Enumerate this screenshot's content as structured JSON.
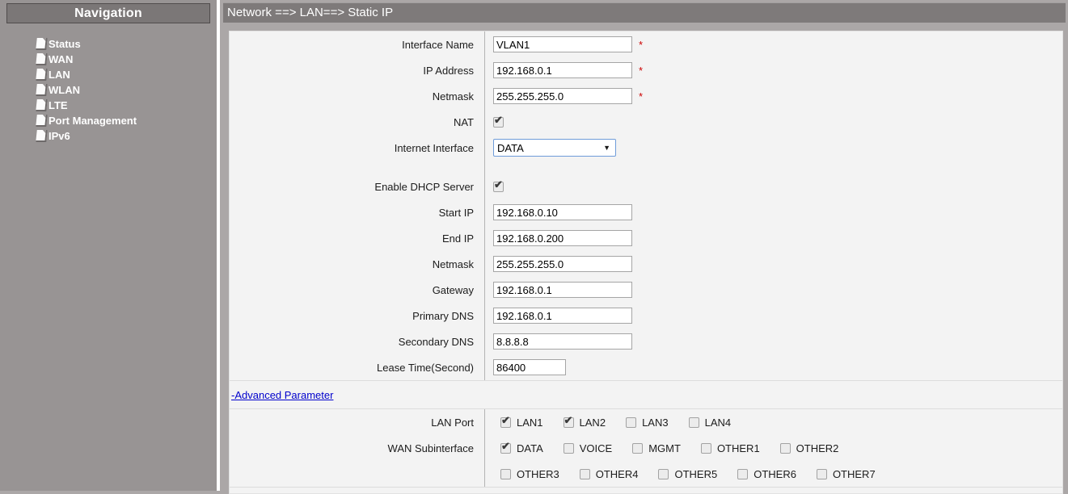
{
  "sidebar": {
    "title": "Navigation",
    "items": [
      "Status",
      "WAN",
      "LAN",
      "WLAN",
      "LTE",
      "Port Management",
      "IPv6"
    ]
  },
  "breadcrumb": "Network ==> LAN==> Static IP",
  "form": {
    "required_marker": "*",
    "sections": [
      {
        "rows": [
          {
            "label": "Interface Name",
            "type": "text",
            "value": "VLAN1",
            "required": true
          },
          {
            "label": "IP Address",
            "type": "text",
            "value": "192.168.0.1",
            "required": true
          },
          {
            "label": "Netmask",
            "type": "text",
            "value": "255.255.255.0",
            "required": true
          },
          {
            "label": "NAT",
            "type": "checkbox",
            "checked": true
          },
          {
            "label": "Internet Interface",
            "type": "select",
            "value": "DATA"
          }
        ]
      },
      {
        "rows": [
          {
            "label": "Enable DHCP Server",
            "type": "checkbox",
            "checked": true
          },
          {
            "label": "Start IP",
            "type": "text",
            "value": "192.168.0.10"
          },
          {
            "label": "End IP",
            "type": "text",
            "value": "192.168.0.200"
          },
          {
            "label": "Netmask",
            "type": "text",
            "value": "255.255.255.0"
          },
          {
            "label": "Gateway",
            "type": "text",
            "value": "192.168.0.1"
          },
          {
            "label": "Primary DNS",
            "type": "text",
            "value": "192.168.0.1"
          },
          {
            "label": "Secondary DNS",
            "type": "text",
            "value": "8.8.8.8"
          },
          {
            "label": "Lease Time(Second)",
            "type": "text",
            "value": "86400",
            "size": "short"
          }
        ]
      }
    ]
  },
  "advanced": {
    "link_label": "-Advanced Parameter"
  },
  "ports": {
    "rows": [
      {
        "label": "LAN Port",
        "options": [
          {
            "label": "LAN1",
            "checked": true
          },
          {
            "label": "LAN2",
            "checked": true
          },
          {
            "label": "LAN3",
            "checked": false
          },
          {
            "label": "LAN4",
            "checked": false
          }
        ]
      },
      {
        "label": "WAN Subinterface",
        "options": [
          {
            "label": "DATA",
            "checked": true
          },
          {
            "label": "VOICE",
            "checked": false
          },
          {
            "label": "MGMT",
            "checked": false
          },
          {
            "label": "OTHER1",
            "checked": false
          },
          {
            "label": "OTHER2",
            "checked": false
          }
        ]
      },
      {
        "label": "",
        "options": [
          {
            "label": "OTHER3",
            "checked": false
          },
          {
            "label": "OTHER4",
            "checked": false
          },
          {
            "label": "OTHER5",
            "checked": false
          },
          {
            "label": "OTHER6",
            "checked": false
          },
          {
            "label": "OTHER7",
            "checked": false
          }
        ]
      }
    ]
  },
  "icons": {
    "select_arrow": "▼",
    "check": "✔"
  },
  "colors": {
    "link_blue": "#0000cc",
    "required_red": "#cc0000",
    "select_border_blue": "#6f9cd9"
  }
}
